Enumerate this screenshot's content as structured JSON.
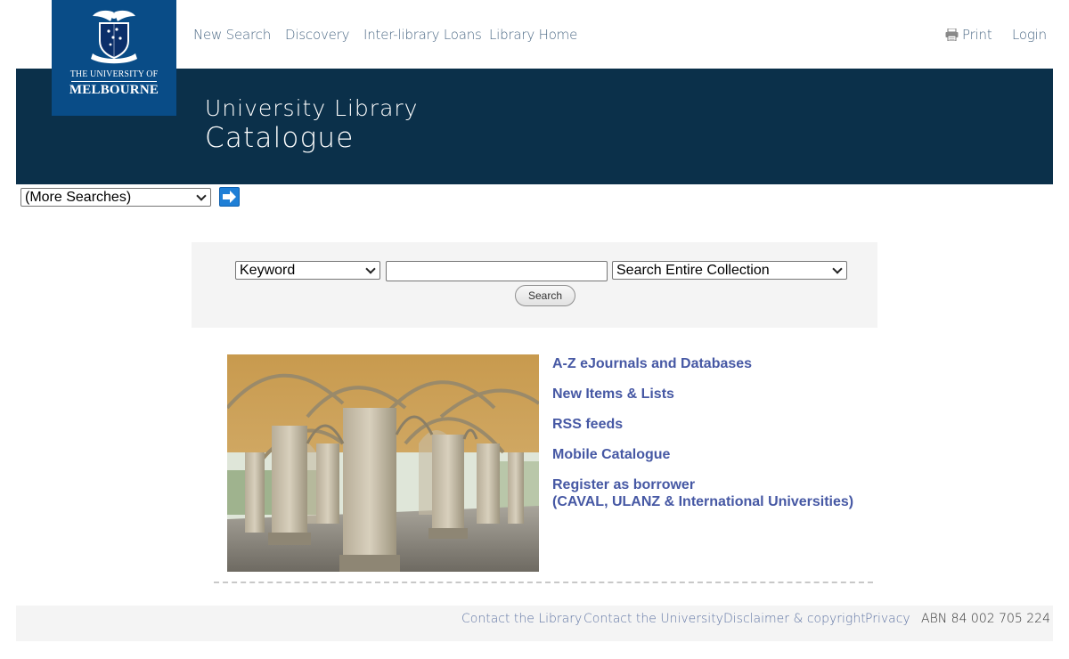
{
  "nav": {
    "new_search": "New Search",
    "discovery": "Discovery",
    "ill": "Inter-library Loans",
    "library_home": "Library Home",
    "print": "Print",
    "login": "Login"
  },
  "logo": {
    "line1": "THE UNIVERSITY OF",
    "line2": "MELBOURNE"
  },
  "banner": {
    "subtitle": "University Library",
    "title": "Catalogue"
  },
  "more_searches": {
    "selected": "(More Searches)"
  },
  "search": {
    "field_selected": "Keyword",
    "query_value": "",
    "collection_selected": "Search Entire Collection",
    "button_label": "Search"
  },
  "links": [
    "A-Z eJournals and Databases",
    "New Items & Lists",
    "RSS feeds",
    "Mobile Catalogue",
    "Register as borrower",
    "(CAVAL, ULANZ & International Universities)"
  ],
  "footer": {
    "contact_library": "Contact the Library",
    "contact_university": "Contact the University",
    "disclaimer": "Disclaimer & copyright",
    "privacy": "Privacy",
    "abn": "ABN 84 002 705 224"
  },
  "colors": {
    "banner": "#0b304a",
    "logo": "#094c87",
    "link": "#4658a4",
    "nav": "#4d6a86"
  },
  "icons": {
    "print": "printer-icon",
    "go": "arrow-right-icon"
  }
}
